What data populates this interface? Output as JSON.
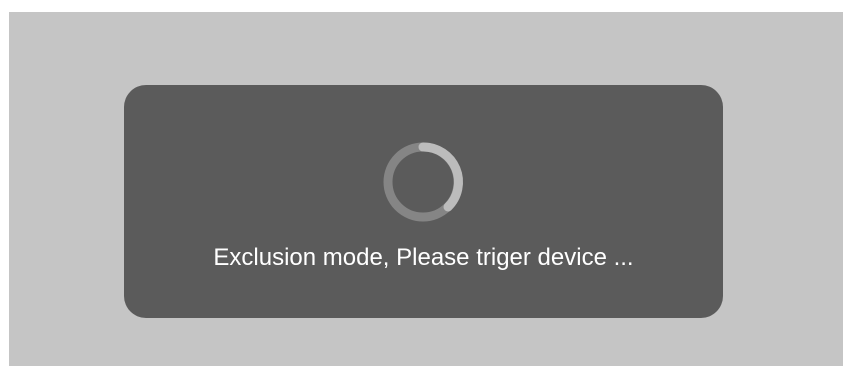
{
  "dialog": {
    "message": "Exclusion mode, Please triger device ...",
    "icon": "loading-spinner-icon"
  },
  "colors": {
    "screen_background": "#c5c5c5",
    "dialog_background": "#5b5b5b",
    "spinner_track": "#8a8a8a",
    "spinner_arc": "#b8b8b8",
    "text": "#ffffff"
  }
}
